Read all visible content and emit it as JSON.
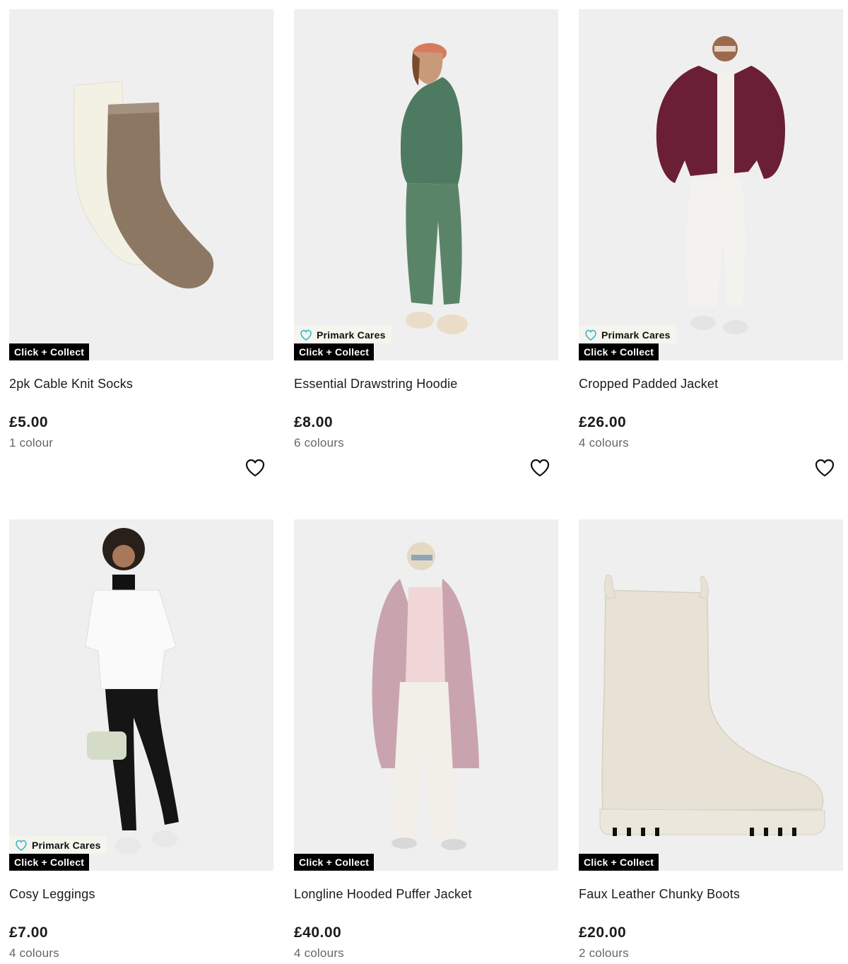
{
  "badges": {
    "click_collect": "Click + Collect",
    "primark_cares": "Primark Cares"
  },
  "colors": {
    "cares_heart": "#2bb3c9",
    "badge_bg": "#000000",
    "price": "#1a1a1a",
    "muted": "#666666"
  },
  "products": [
    {
      "title": "2pk Cable Knit Socks",
      "price": "£5.00",
      "colours": "1 colour",
      "primark_cares": false,
      "click_collect": true,
      "image": "socks-image"
    },
    {
      "title": "Essential Drawstring Hoodie",
      "price": "£8.00",
      "colours": "6 colours",
      "primark_cares": true,
      "click_collect": true,
      "image": "hoodie-image"
    },
    {
      "title": "Cropped Padded Jacket",
      "price": "£26.00",
      "colours": "4 colours",
      "primark_cares": true,
      "click_collect": true,
      "image": "jacket-image"
    },
    {
      "title": "Cosy Leggings",
      "price": "£7.00",
      "colours": "4 colours",
      "primark_cares": true,
      "click_collect": true,
      "image": "leggings-image"
    },
    {
      "title": "Longline Hooded Puffer Jacket",
      "price": "£40.00",
      "colours": "4 colours",
      "primark_cares": false,
      "click_collect": true,
      "image": "puffer-image"
    },
    {
      "title": "Faux Leather Chunky Boots",
      "price": "£20.00",
      "colours": "2 colours",
      "primark_cares": false,
      "click_collect": true,
      "image": "boots-image"
    }
  ]
}
